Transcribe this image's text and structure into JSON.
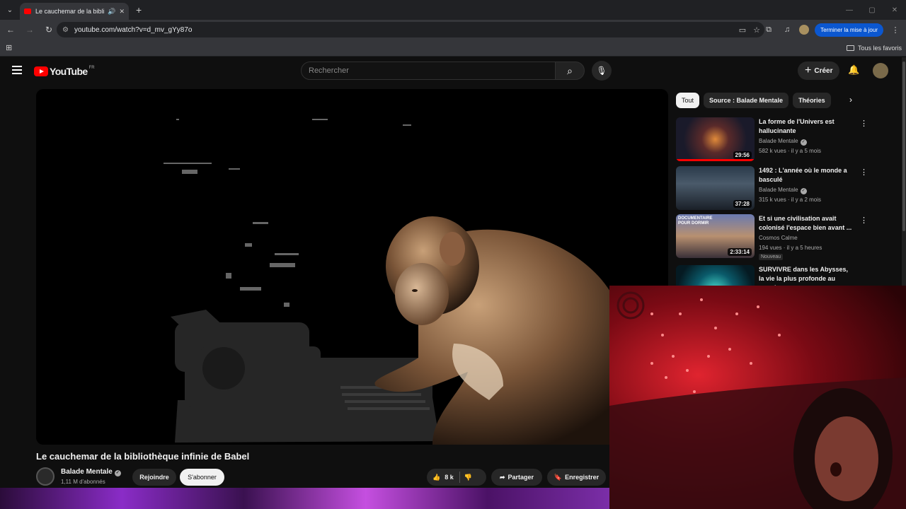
{
  "browser": {
    "tab_title": "Le cauchemar de la biblioth",
    "url": "youtube.com/watch?v=d_mv_gYy87o",
    "update_button": "Terminer la mise à jour",
    "all_bookmarks": "Tous les favoris"
  },
  "youtube": {
    "region": "FR",
    "logo_text": "YouTube",
    "search_placeholder": "Rechercher",
    "create_label": "Créer"
  },
  "video": {
    "title": "Le cauchemar de la bibliothèque infinie de Babel",
    "channel": "Balade Mentale",
    "subscribers": "1,11 M d'abonnés",
    "join_label": "Rejoindre",
    "subscribe_label": "S'abonner",
    "likes": "8 k",
    "share_label": "Partager",
    "save_label": "Enregistrer"
  },
  "chips": [
    "Tout",
    "Source : Balade Mentale",
    "Théories"
  ],
  "recommendations": [
    {
      "title": "La forme de l'Univers est hallucinante",
      "channel": "Balade Mentale",
      "meta": "582 k vues · il y a 5 mois",
      "duration": "29:56",
      "badge": "",
      "watched": 1.0
    },
    {
      "title": "1492 : L'année où le monde a basculé",
      "channel": "Balade Mentale",
      "meta": "315 k vues · il y a 2 mois",
      "duration": "37:28",
      "badge": "",
      "watched": 0
    },
    {
      "title": "Et si une civilisation avait colonisé l'espace bien avant ...",
      "channel": "Cosmos Calme",
      "meta": "194 vues · il y a 5 heures",
      "duration": "2:33:14",
      "badge": "Nouveau",
      "watched": 0
    },
    {
      "title": "SURVIVRE dans les Abysses, la vie la plus profonde au monde",
      "channel": "",
      "meta": "",
      "duration": "",
      "badge": "",
      "watched": 0
    }
  ],
  "thumb_text": "DOCUMENTAIRE POUR DORMIR"
}
